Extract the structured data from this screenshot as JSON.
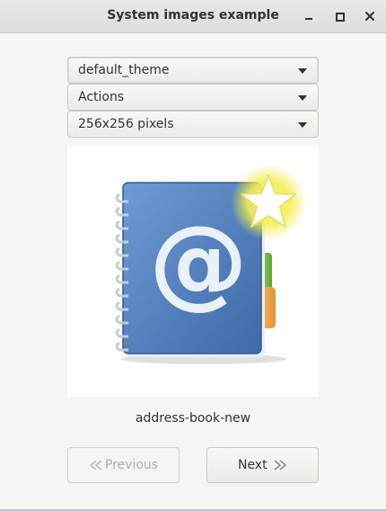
{
  "window": {
    "title": "System images example"
  },
  "controls": {
    "minimize_icon": "minimize-icon",
    "maximize_icon": "maximize-icon",
    "close_icon": "close-icon"
  },
  "combos": {
    "theme": {
      "value": "default_theme"
    },
    "context": {
      "value": "Actions"
    },
    "size": {
      "value": "256x256 pixels"
    }
  },
  "image": {
    "icon_name": "address-book-icon",
    "caption": "address-book-new"
  },
  "buttons": {
    "previous": {
      "label": "Previous",
      "enabled": false
    },
    "next": {
      "label": "Next",
      "enabled": true
    }
  },
  "colors": {
    "book_blue": "#4f80bf",
    "star_glow": "#f4ee4a",
    "background": "#f6f5f4"
  }
}
